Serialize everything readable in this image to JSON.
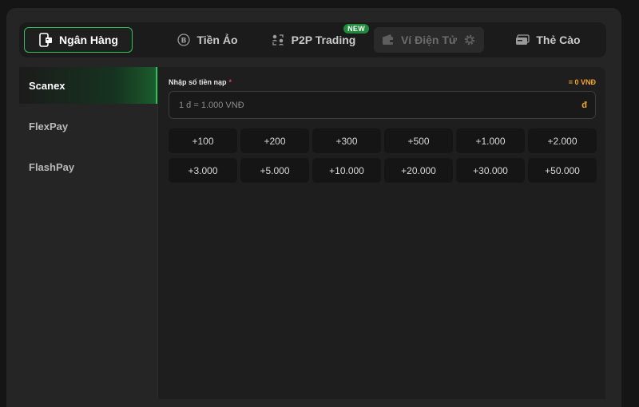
{
  "tabs": [
    {
      "label": "Ngân Hàng",
      "icon": "bank-phone-icon",
      "state": "active"
    },
    {
      "label": "Tiền Ảo",
      "icon": "bitcoin-icon",
      "state": "normal"
    },
    {
      "label": "P2P Trading",
      "icon": "p2p-users-icon",
      "state": "normal",
      "badge": "NEW"
    },
    {
      "label": "Ví Điện Tử",
      "icon": "wallet-icon",
      "state": "disabled",
      "extra_icon": "gear-icon"
    },
    {
      "label": "Thẻ Cào",
      "icon": "card-icon",
      "state": "normal"
    }
  ],
  "sidebar": {
    "items": [
      {
        "label": "Scanex",
        "active": true
      },
      {
        "label": "FlexPay",
        "active": false
      },
      {
        "label": "FlashPay",
        "active": false
      }
    ]
  },
  "form": {
    "label": "Nhập số tiền nạp",
    "required_mark": "*",
    "conversion": "= 0 VNĐ",
    "placeholder": "1 đ = 1.000 VNĐ",
    "value": "",
    "currency_symbol": "đ"
  },
  "amount_buttons": [
    "+100",
    "+200",
    "+300",
    "+500",
    "+1.000",
    "+2.000",
    "+3.000",
    "+5.000",
    "+10.000",
    "+20.000",
    "+30.000",
    "+50.000"
  ],
  "colors": {
    "accent_green": "#2fc15a",
    "orange": "#f5a623",
    "required_red": "#e04848"
  }
}
